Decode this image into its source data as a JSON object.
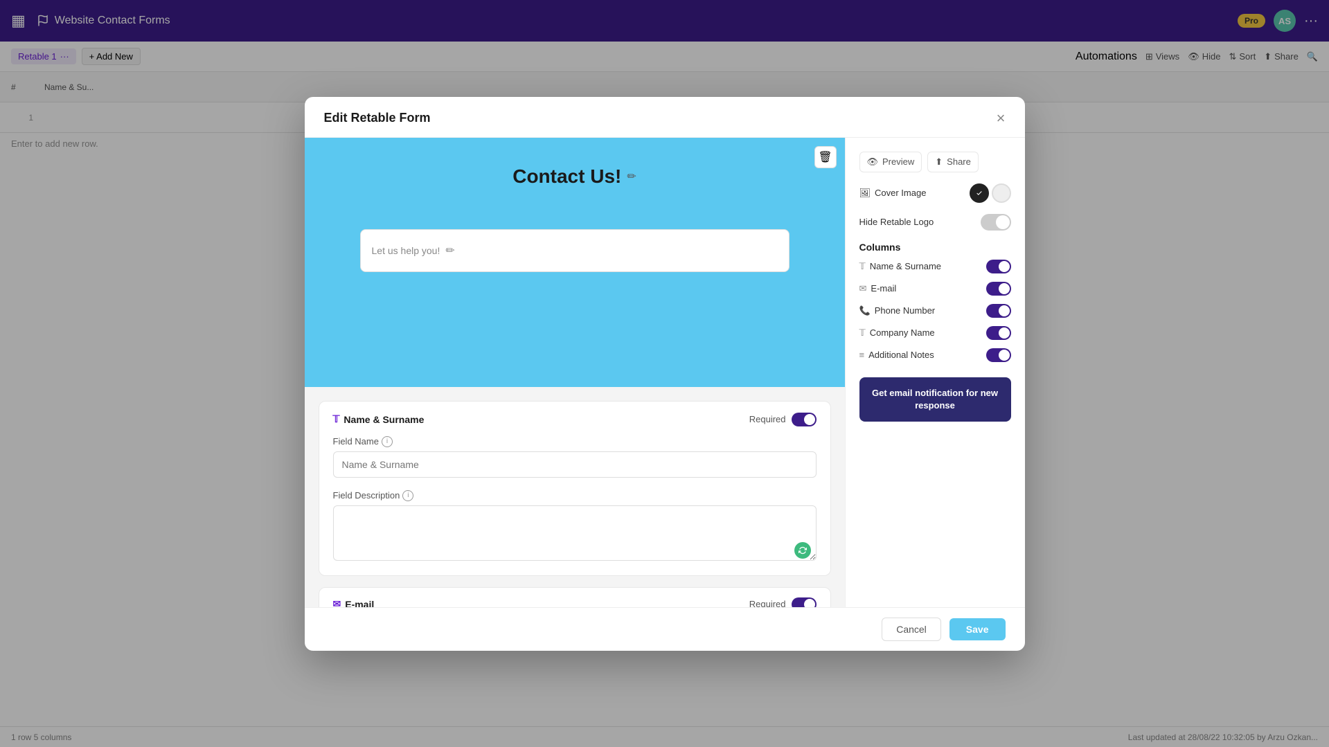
{
  "app": {
    "title": "Website Contact Forms",
    "logo": "▦"
  },
  "navbar": {
    "title": "Website Contact Forms",
    "pro_label": "Pro",
    "avatar_initials": "AS",
    "more_label": "···"
  },
  "tabbar": {
    "tab1_label": "Retable 1",
    "add_label": "+ Add New",
    "views_label": "Views",
    "hide_label": "Hide",
    "sort_label": "Sort",
    "share_label": "Share",
    "search_icon": "🔍",
    "automations_label": "Automations"
  },
  "table": {
    "header_num": "#",
    "header_col1": "Name & Su...",
    "row1_num": "1",
    "add_row_label": "Enter to add new row."
  },
  "statusbar": {
    "left": "1 row  5 columns",
    "right": "Last updated at 28/08/22 10:32:05 by Arzu Ozkan..."
  },
  "modal": {
    "title": "Edit Retable Form",
    "close_label": "×",
    "form": {
      "title": "Contact Us!",
      "title_edit_icon": "✏",
      "subtitle": "Let us help you!",
      "subtitle_edit_icon": "✏",
      "delete_icon": "🗑",
      "field1": {
        "name": "Name & Surname",
        "type_icon": "T",
        "required_label": "Required",
        "field_name_label": "Field Name",
        "field_name_info": "ℹ",
        "field_name_placeholder": "Name & Surname",
        "field_desc_label": "Field Description",
        "field_desc_info": "ℹ"
      },
      "field2": {
        "name": "E-mail",
        "type_icon": "✉",
        "required_label": "Required"
      }
    },
    "right_panel": {
      "preview_label": "Preview",
      "share_label": "Share",
      "cover_image_label": "Cover Image",
      "hide_logo_label": "Hide Retable Logo",
      "columns_title": "Columns",
      "columns": [
        {
          "icon": "T",
          "label": "Name & Surname"
        },
        {
          "icon": "✉",
          "label": "E-mail"
        },
        {
          "icon": "📞",
          "label": "Phone Number"
        },
        {
          "icon": "T",
          "label": "Company Name"
        },
        {
          "icon": "≡",
          "label": "Additional Notes"
        }
      ],
      "notif_button_label": "Get email notification for new response"
    },
    "footer": {
      "cancel_label": "Cancel",
      "save_label": "Save"
    }
  }
}
